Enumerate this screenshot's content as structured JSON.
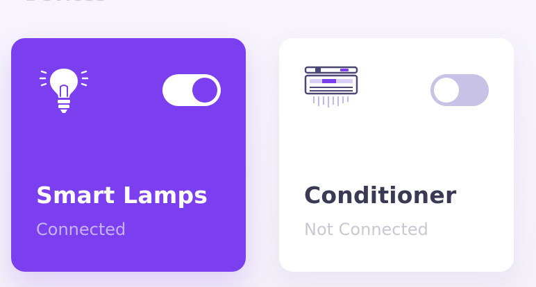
{
  "header": {
    "section_title_fragment": "Devices"
  },
  "devices": [
    {
      "name": "Smart Lamps",
      "status": "Connected",
      "icon": "lightbulb-icon",
      "toggle_on": true
    },
    {
      "name": "Conditioner",
      "status": "Not Connected",
      "icon": "air-conditioner-icon",
      "toggle_on": false
    }
  ],
  "colors": {
    "accent": "#7b3ff0",
    "card_off_bg": "#ffffff",
    "toggle_off_track": "#c8c3e6",
    "title_dark": "#3b3a55",
    "status_muted": "#cac8d3",
    "page_bg": "#f6f3fb"
  }
}
